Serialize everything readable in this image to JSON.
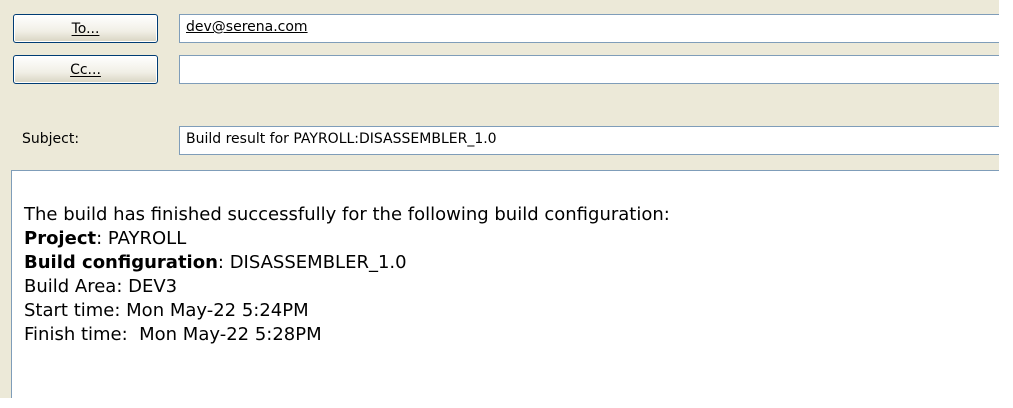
{
  "header": {
    "to_button": {
      "label": "To..."
    },
    "cc_button": {
      "label": "Cc..."
    },
    "to_value": "dev@serena.com",
    "cc_value": "",
    "subject_label": "Subject:",
    "subject_value": "Build result for PAYROLL:DISASSEMBLER_1.0"
  },
  "message": {
    "intro": "The build has finished successfully for the following build configuration:",
    "project_label": "Project",
    "project_value": ": PAYROLL",
    "config_label": "Build configuration",
    "config_value": ": DISASSEMBLER_1.0",
    "build_area": "Build Area: DEV3",
    "start_time": "Start time: Mon May-22 5:24PM",
    "finish_time": "Finish time:  Mon May-22 5:28PM"
  }
}
